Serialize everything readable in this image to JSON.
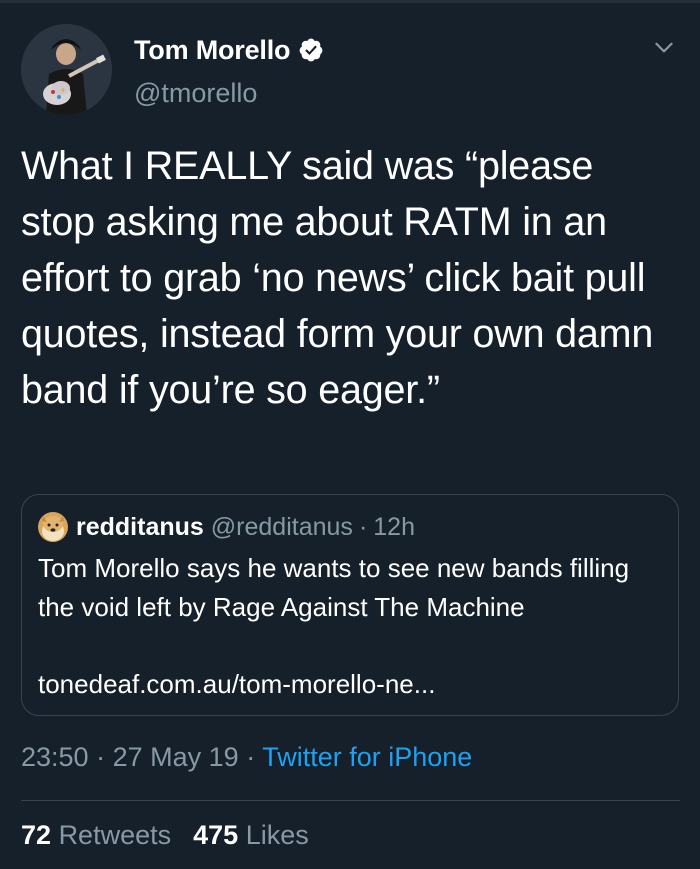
{
  "tweet": {
    "author": {
      "name": "Tom Morello",
      "handle": "@tmorello"
    },
    "text": "What I REALLY said was “please stop asking me about RATM in an effort to grab ‘no news’ click bait pull quotes, instead form your own damn band if you’re so eager.”",
    "quote": {
      "name": "redditanus",
      "handle": "@redditanus",
      "separator": "·",
      "time": "12h",
      "text": "Tom Morello says he wants to see new bands filling the void left by Rage Against The Machine",
      "link": "tonedeaf.com.au/tom-morello-ne..."
    },
    "meta": {
      "time": "23:50",
      "separator": "·",
      "date": "27 May 19",
      "source": "Twitter for iPhone"
    },
    "stats": {
      "retweets_count": "72",
      "retweets_label": "Retweets",
      "likes_count": "475",
      "likes_label": "Likes"
    }
  },
  "colors": {
    "background": "#15202b",
    "text_primary": "#ffffff",
    "text_secondary": "#8899a6",
    "accent": "#1da1f2",
    "border": "#38444d"
  },
  "icons": {
    "verified": "verified-badge-icon",
    "chevron": "chevron-down-icon"
  }
}
